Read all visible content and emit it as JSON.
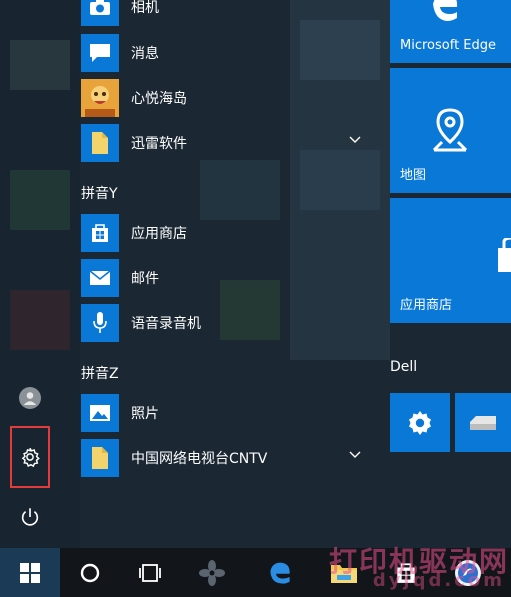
{
  "apps": [
    {
      "label": "相机",
      "icon": "camera-icon"
    },
    {
      "label": "消息",
      "icon": "message-icon"
    },
    {
      "label": "心悦海岛",
      "icon": "game-icon"
    },
    {
      "label": "迅雷软件",
      "icon": "folder-icon"
    }
  ],
  "groups": [
    {
      "header": "拼音Y",
      "apps": [
        {
          "label": "应用商店",
          "icon": "store-icon"
        },
        {
          "label": "邮件",
          "icon": "mail-icon"
        },
        {
          "label": "语音录音机",
          "icon": "microphone-icon"
        }
      ]
    },
    {
      "header": "拼音Z",
      "apps": [
        {
          "label": "照片",
          "icon": "photos-icon"
        },
        {
          "label": "中国网络电视台CNTV",
          "icon": "folder-icon"
        }
      ]
    }
  ],
  "tiles": {
    "edge": "Microsoft Edge",
    "maps": "地图",
    "store": "应用商店",
    "section_dell": "Dell"
  },
  "colors": {
    "accent": "#0a78d7",
    "highlight": "#e23b3b",
    "taskbar": "#12161b"
  },
  "watermark": {
    "text": "打印机驱动网",
    "url": "dyjqd.com"
  }
}
